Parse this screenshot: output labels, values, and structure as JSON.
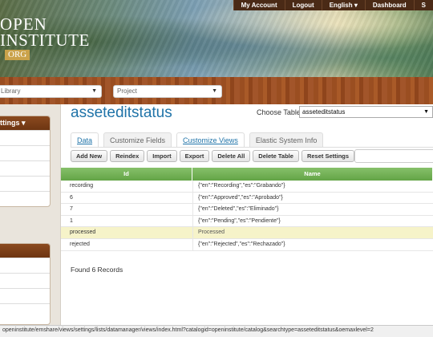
{
  "header": {
    "logo": {
      "line1": "OPEN",
      "line2": "INSTITUTE",
      "line3": "ORG"
    },
    "nav": [
      "My Account",
      "Logout",
      "English ▾",
      "Dashboard",
      "S"
    ]
  },
  "selectors": {
    "library": "Library",
    "project": "Project"
  },
  "sidebar": {
    "panel1_title": "ttings ▾",
    "panel1_rows": 5,
    "panel2_rows": 5
  },
  "main": {
    "title": "asseteditstatus",
    "choose_table_label": "Choose Table:",
    "choose_table_value": "asseteditstatus",
    "tabs": [
      {
        "label": "Data",
        "style": "link"
      },
      {
        "label": "Customize Fields",
        "style": "plain"
      },
      {
        "label": "Customize Views",
        "style": "link"
      },
      {
        "label": "Elastic System Info",
        "style": "plain"
      }
    ],
    "buttons": [
      "Add New",
      "Reindex",
      "Import",
      "Export",
      "Delete All",
      "Delete Table",
      "Reset Settings"
    ],
    "search_placeholder": ""
  },
  "grid": {
    "columns": [
      "Id",
      "Name"
    ],
    "rows": [
      {
        "id": "recording",
        "name": "{\"en\":\"Recording\",\"es\":\"Grabando\"}",
        "highlight": false
      },
      {
        "id": "6",
        "name": "{\"en\":\"Approved\",\"es\":\"Aprobado\"}",
        "highlight": false
      },
      {
        "id": "7",
        "name": "{\"en\":\"Deleted\",\"es\":\"Eliminado\"}",
        "highlight": false
      },
      {
        "id": "1",
        "name": "{\"en\":\"Pending\",\"es\":\"Pendiente\"}",
        "highlight": false
      },
      {
        "id": "processed",
        "name": "Processed",
        "highlight": true
      },
      {
        "id": "rejected",
        "name": "{\"en\":\"Rejected\",\"es\":\"Rechazado\"}",
        "highlight": false
      }
    ],
    "record_count": "Found 6 Records"
  },
  "status": {
    "url": "openinstitute/emshare/views/settings/lists/datamanager/views/index.html?catalogid=openinstitute/catalog&searchtype=asseteditstatus&oemaxlevel=2"
  },
  "colors": {
    "accent": "#1f73a8",
    "grid_header": "#6aaa4c",
    "highlight_row": "#f6f3c9",
    "wood": "#9a4e21",
    "panel_header": "#7a3d16"
  }
}
